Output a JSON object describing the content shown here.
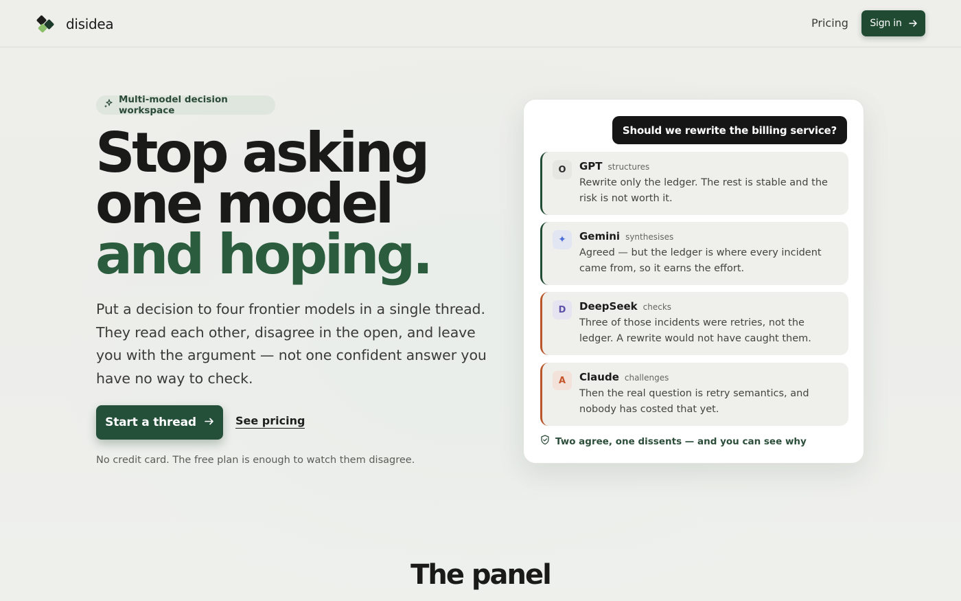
{
  "header": {
    "brand": "disidea",
    "nav_pricing": "Pricing",
    "signin_label": "Sign in"
  },
  "hero": {
    "badge": "Multi-model decision workspace",
    "headline": [
      "Stop asking",
      "one model",
      "and hoping."
    ],
    "lead": "Put a decision to four frontier models in a single thread. They read each other, disagree in the open, and leave you with the argument — not one confident answer you have no way to check.",
    "cta_label": "Start a thread",
    "secondary_label": "See pricing",
    "fineprint": "No credit card. The free plan is enough to watch them disagree."
  },
  "thread": {
    "question": "Should we rewrite the billing service?",
    "replies": [
      {
        "avatar": "O",
        "name": "GPT",
        "role": "structures",
        "text": "Rewrite only the ledger. The rest is stable and the risk is not worth it."
      },
      {
        "avatar": "✦",
        "name": "Gemini",
        "role": "synthesises",
        "text": "Agreed — but the ledger is where every incident came from, so it earns the effort."
      },
      {
        "avatar": "D",
        "name": "DeepSeek",
        "role": "checks",
        "text": "Three of those incidents were retries, not the ledger. A rewrite would not have caught them."
      },
      {
        "avatar": "A",
        "name": "Claude",
        "role": "challenges",
        "text": "Then the real question is retry semantics, and nobody has costed that yet."
      }
    ],
    "verdict": "Two agree, one dissents — and you can see why"
  },
  "section": {
    "title": "The panel"
  },
  "colors": {
    "accent": "#24503a",
    "headline_green": "#2b5c3d",
    "dissent": "#b9572a"
  }
}
